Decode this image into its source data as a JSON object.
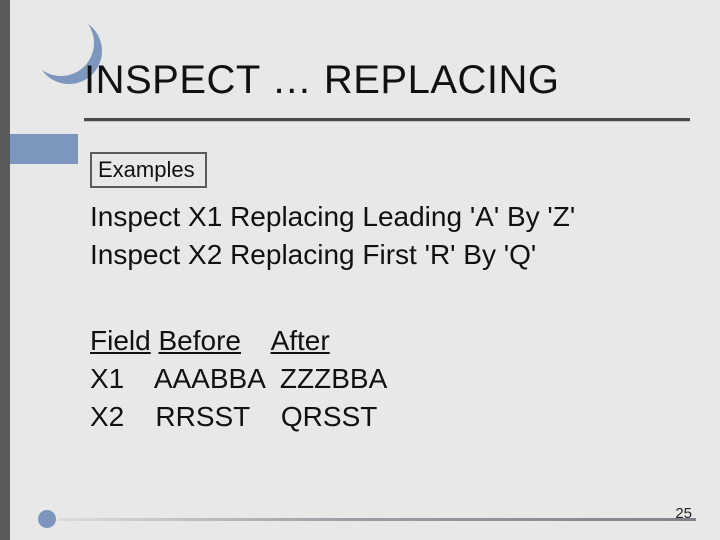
{
  "title": "INSPECT … REPLACING",
  "examples_label": "Examples",
  "code_lines": [
    "Inspect X1 Replacing Leading 'A' By 'Z'",
    "Inspect X2 Replacing First 'R' By 'Q'"
  ],
  "table": {
    "headers": {
      "field": "Field",
      "before": "Before",
      "after": "After"
    },
    "rows": [
      {
        "field": "X1",
        "before": "AAABBA",
        "after": "ZZZBBA"
      },
      {
        "field": "X2",
        "before": "RRSST",
        "after": "QRSST"
      }
    ]
  },
  "slide_number": "25"
}
